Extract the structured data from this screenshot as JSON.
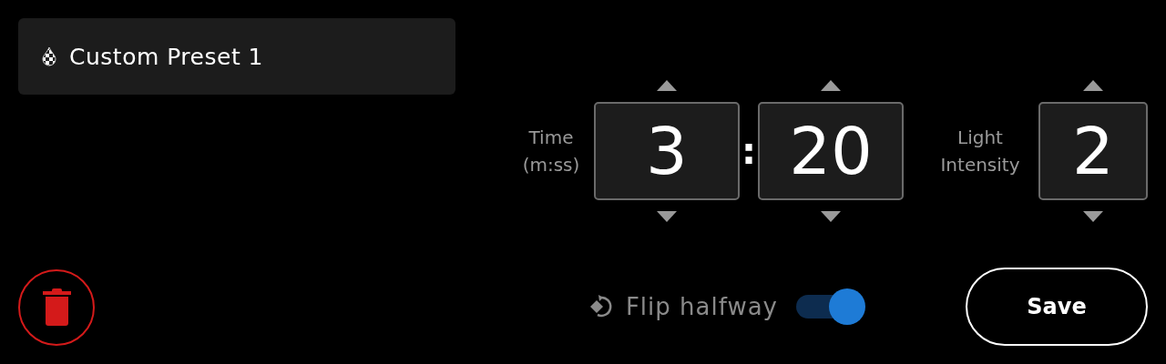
{
  "preset": {
    "name": "Custom Preset 1"
  },
  "time": {
    "label": "Time (m:ss)",
    "minutes": "3",
    "separator": ":",
    "seconds": "20"
  },
  "light_intensity": {
    "label": "Light Intensity",
    "value": "2"
  },
  "flip_halfway": {
    "label": "Flip halfway",
    "on": true
  },
  "save_button": {
    "label": "Save"
  }
}
